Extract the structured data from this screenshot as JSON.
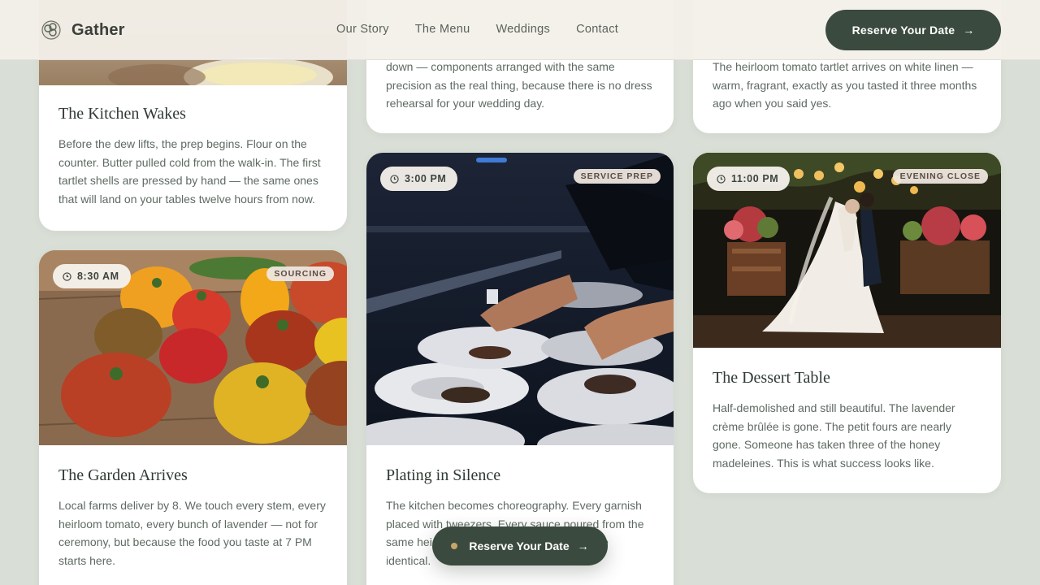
{
  "brand": {
    "name": "Gather",
    "logo_icon": "flower-logo-icon"
  },
  "nav": {
    "links": [
      "Our Story",
      "The Menu",
      "Weddings",
      "Contact"
    ],
    "cta_label": "Reserve Your Date",
    "cta_icon": "arrow-right-icon"
  },
  "cards": {
    "kitchen": {
      "title": "The Kitchen Wakes",
      "text": "Before the dew lifts, the prep begins. Flour on the counter. Butter pulled cold from the walk-in. The first tartlet shells are pressed by hand — the same ones that will land on your tables twelve hours from now."
    },
    "rehearsal": {
      "text": "down — components arranged with the same precision as the real thing, because there is no dress rehearsal for your wedding day."
    },
    "tasting": {
      "text": "The heirloom tomato tartlet arrives on white linen — warm, fragrant, exactly as you tasted it three months ago when you said yes."
    },
    "garden": {
      "time": "8:30 AM",
      "tag": "SOURCING",
      "title": "The Garden Arrives",
      "text": "Local farms deliver by 8. We touch every stem, every heirloom tomato, every bunch of lavender — not for ceremony, but because the food you taste at 7 PM starts here."
    },
    "plating": {
      "time": "3:00 PM",
      "tag": "SERVICE PREP",
      "title": "Plating in Silence",
      "text": "The kitchen becomes choreography. Every garnish placed with tweezers. Every sauce poured from the same height. Every plate a twin — each one identical."
    },
    "dessert": {
      "time": "11:00 PM",
      "tag": "EVENING CLOSE",
      "title": "The Dessert Table",
      "text": "Half-demolished and still beautiful. The lavender crème brûlée is gone. The petit fours are nearly gone. Someone has taken three of the honey madeleines. This is what success looks like."
    }
  },
  "floating_cta": {
    "label": "Reserve Your Date"
  },
  "colors": {
    "background": "#d9dfd6",
    "accent_dark_green": "#3b4a3f",
    "text": "#2f3a33",
    "muted_text": "#5e6a62"
  }
}
